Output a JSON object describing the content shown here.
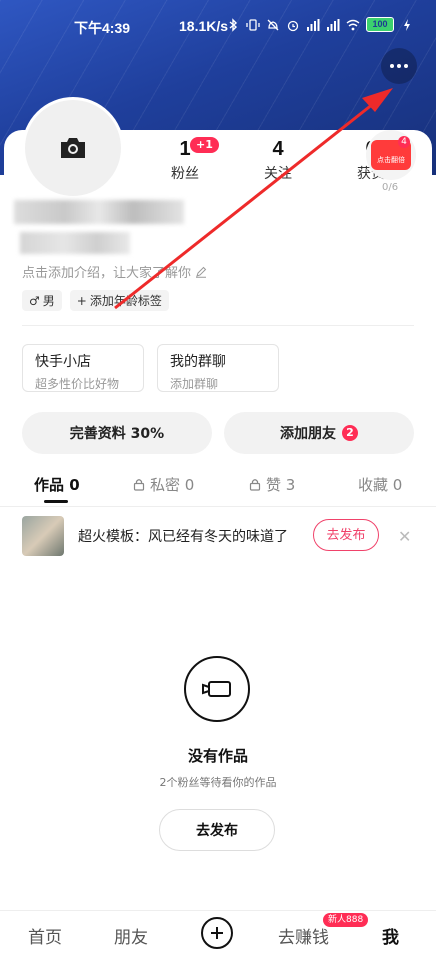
{
  "status_bar": {
    "time": "下午4:39",
    "speed": "18.1K/s",
    "battery": "100"
  },
  "stats": [
    {
      "num": "1",
      "label": "粉丝",
      "badge": "+1"
    },
    {
      "num": "4",
      "label": "关注"
    },
    {
      "num": "0",
      "label": "获赞"
    }
  ],
  "gift": {
    "text": "点击翻倍",
    "badge": "4",
    "progress": "0/6"
  },
  "profile": {
    "intro_placeholder": "点击添加介绍，让大家了解你",
    "gender_tag": "男",
    "age_tag": "添加年龄标签"
  },
  "shortcuts": [
    {
      "title": "快手小店",
      "sub": "超多性价比好物"
    },
    {
      "title": "我的群聊",
      "sub": "添加群聊"
    }
  ],
  "actions": {
    "complete_profile": "完善资料 30%",
    "add_friends": "添加朋友",
    "add_friends_count": "2"
  },
  "tabs": [
    {
      "label": "作品 0"
    },
    {
      "label": "私密 0"
    },
    {
      "label": "赞 3"
    },
    {
      "label": "收藏 0"
    }
  ],
  "template": {
    "text": "超火模板：风已经有冬天的味道了",
    "button": "去发布"
  },
  "empty": {
    "title": "没有作品",
    "sub": "2个粉丝等待看你的作品",
    "button": "去发布"
  },
  "nav": {
    "home": "首页",
    "friends": "朋友",
    "earn": "去赚钱",
    "earn_badge": "新人888",
    "me": "我"
  },
  "colors": {
    "accent": "#ff2d55",
    "header": "#2447a8",
    "arrow": "#ee2a2a"
  }
}
